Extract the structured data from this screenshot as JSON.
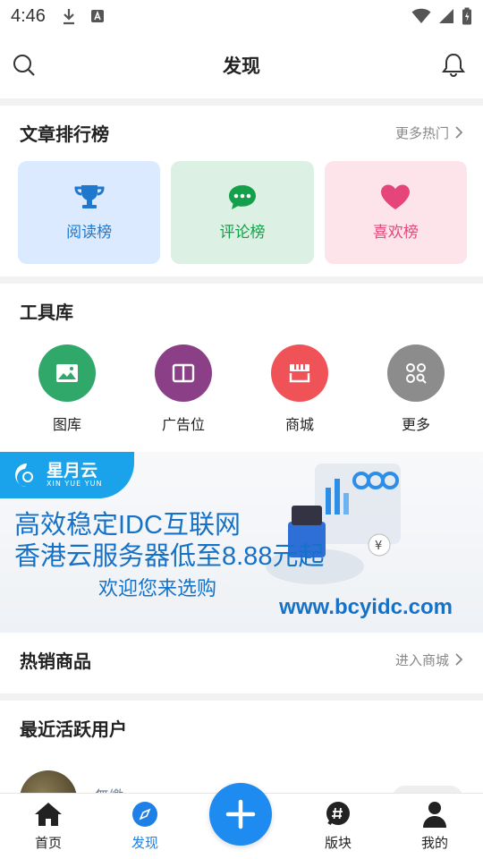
{
  "status_bar": {
    "time": "4:46"
  },
  "topbar": {
    "title": "发现"
  },
  "articles": {
    "heading": "文章排行榜",
    "more": "更多热门",
    "cards": [
      {
        "label": "阅读榜",
        "icon": "trophy-icon",
        "color": "#1e78ce"
      },
      {
        "label": "评论榜",
        "icon": "chat-bubble-icon",
        "color": "#14a04a"
      },
      {
        "label": "喜欢榜",
        "icon": "heart-icon",
        "color": "#e5457a"
      }
    ]
  },
  "tools": {
    "heading": "工具库",
    "items": [
      {
        "label": "图库",
        "icon": "image-icon",
        "color": "#2fa86a"
      },
      {
        "label": "广告位",
        "icon": "book-icon",
        "color": "#8a3f86"
      },
      {
        "label": "商城",
        "icon": "shop-icon",
        "color": "#ef5358"
      },
      {
        "label": "更多",
        "icon": "grid-search-icon",
        "color": "#8c8c8c"
      }
    ]
  },
  "banner": {
    "brand": "星月云",
    "brand_sub": "XIN YUE YUN",
    "line1": "高效稳定IDC互联网",
    "line2": "香港云服务器低至8.88元起",
    "line3": "欢迎您来选购",
    "url": "www.bcyidc.com"
  },
  "hot_products": {
    "heading": "热销商品",
    "more": "进入商城"
  },
  "active_users": {
    "heading": "最近活跃用户",
    "users": [
      {
        "name": "無繳"
      }
    ]
  },
  "bottom_nav": {
    "items": [
      {
        "label": "首页",
        "icon": "home-icon"
      },
      {
        "label": "发现",
        "icon": "compass-icon",
        "active": true
      },
      {
        "label": "版块",
        "icon": "hashtag-icon"
      },
      {
        "label": "我的",
        "icon": "user-icon"
      }
    ],
    "accent": "#1d8bf0"
  }
}
